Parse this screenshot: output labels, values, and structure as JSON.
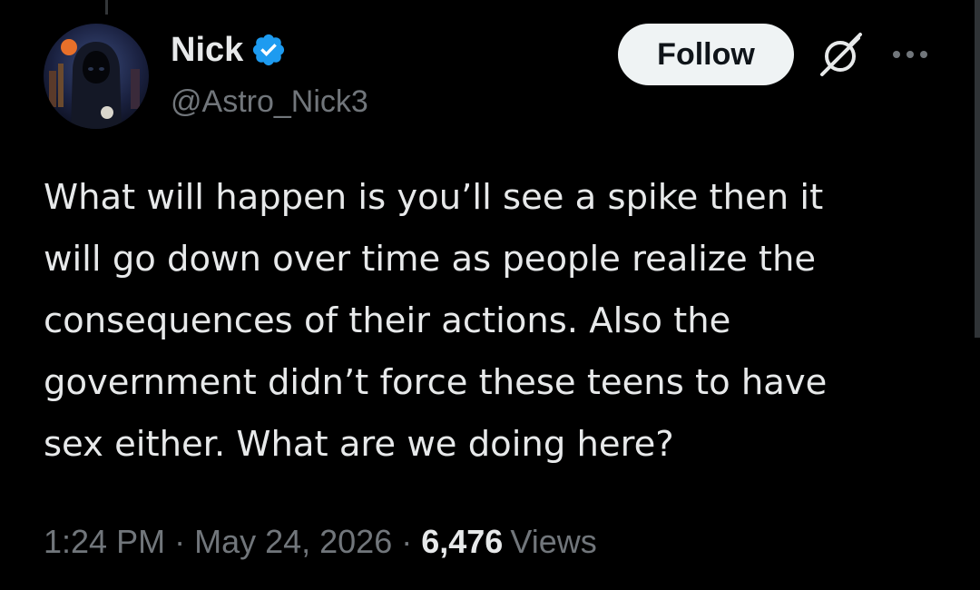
{
  "tweet": {
    "author": {
      "display_name": "Nick",
      "handle": "@Astro_Nick3",
      "verified": true,
      "avatar_icon": "hooded-figure-avatar"
    },
    "actions": {
      "follow_label": "Follow",
      "grok_icon": "grok-icon",
      "more_icon": "more-options-icon"
    },
    "text_lines": [
      "What will happen is you’ll see a spike then it",
      "will go down over time as people realize the",
      "consequences of their actions. Also the",
      "government didn’t force these teens to have",
      "sex either. What are we doing here?"
    ],
    "meta": {
      "time": "1:24 PM",
      "separator": "·",
      "date": "May 24, 2026",
      "views_count": "6,476",
      "views_label": "Views"
    }
  },
  "colors": {
    "background": "#000000",
    "text_primary": "#e7e9ea",
    "text_secondary": "#71767b",
    "verified_blue": "#1d9bf0",
    "follow_bg": "#eff3f4",
    "follow_text": "#0f1419"
  }
}
